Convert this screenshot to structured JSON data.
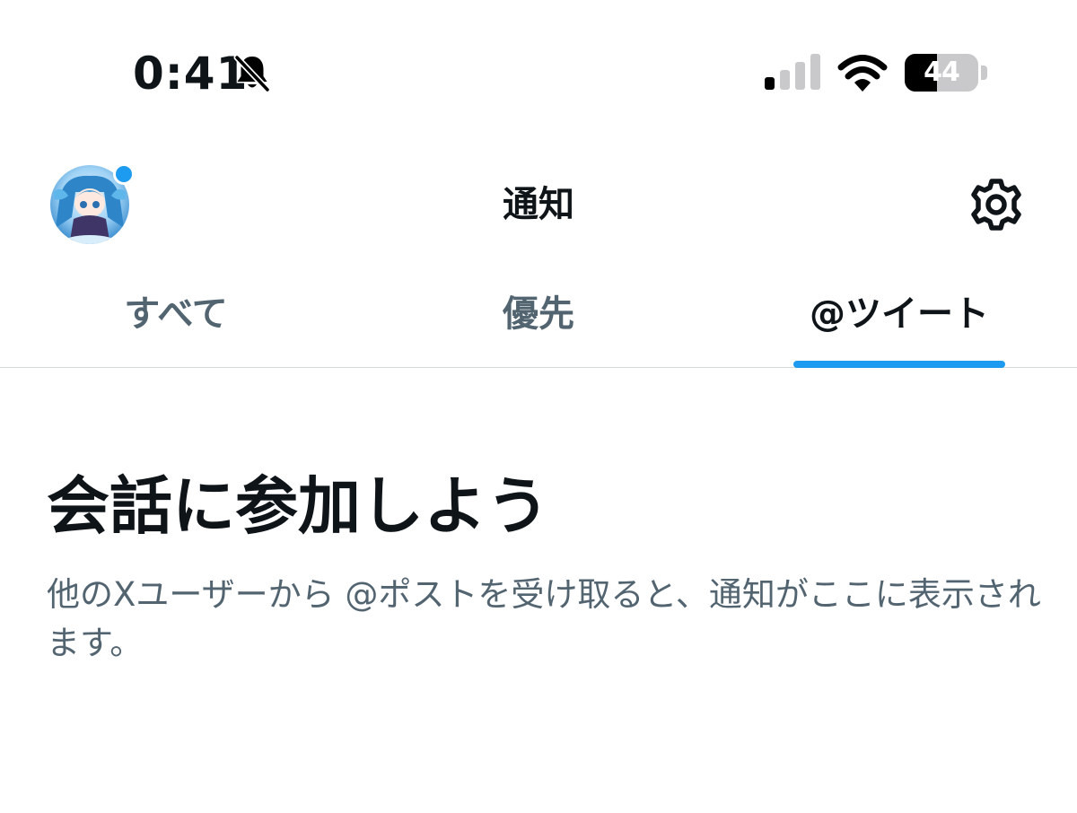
{
  "status_bar": {
    "time": "0:41",
    "battery_level": "44",
    "battery_fraction": 0.44,
    "signal_bars_active": 1,
    "signal_bars_total": 4,
    "icons": [
      "bell-slash-icon",
      "cellular-signal-icon",
      "wifi-icon",
      "battery-icon"
    ]
  },
  "header": {
    "title": "通知",
    "avatar_has_notification_dot": true,
    "settings_icon": "gear-icon"
  },
  "tabs": [
    {
      "label": "すべて",
      "active": false
    },
    {
      "label": "優先",
      "active": false
    },
    {
      "label": "@ツイート",
      "active": true
    }
  ],
  "empty_state": {
    "title": "会話に参加しよう",
    "message": "他のXユーザーから @ポストを受け取ると、通知がここに表示されます。"
  },
  "colors": {
    "accent": "#1d9bf0",
    "text_primary": "#0f1419",
    "text_secondary": "#536471",
    "divider": "#d6d9db",
    "background": "#ffffff"
  }
}
